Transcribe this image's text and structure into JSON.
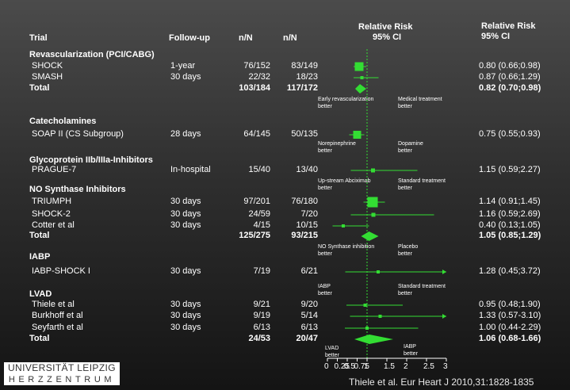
{
  "logo": {
    "line1": "UNIVERSITÄT LEIPZIG",
    "line2": "HERZZENTRUM"
  },
  "citation": "Thiele et al. Eur Heart J 2010,31:1828-1835",
  "chart_data": {
    "type": "forest",
    "headers": {
      "trial": "Trial",
      "followup": "Follow-up",
      "n1": "n/N",
      "n2": "n/N",
      "rr_line1": "Relative Risk",
      "rr_line2": "95% CI",
      "est_line1": "Relative Risk",
      "est_line2": "95% CI"
    },
    "axis": {
      "min": 0,
      "max": 3,
      "ticks": [
        0,
        0.25,
        0.5,
        0.75,
        1,
        1.5,
        2,
        2.5,
        3
      ],
      "tick_labels": [
        "0",
        "0.25",
        "0.5",
        "0.75",
        "1",
        "1.5",
        "2",
        "2.5",
        "3"
      ],
      "reference_line": 1,
      "left_label": "LVAD\nbetter",
      "right_label": "IABP\nbetter"
    },
    "colors": {
      "marker": "#33dd33",
      "text": "#ffffff",
      "reference": "#33dd33"
    },
    "rows": [
      {
        "kind": "section",
        "label": "Revascularization (PCI/CABG)"
      },
      {
        "kind": "study",
        "label": "SHOCK",
        "followup": "1-year",
        "n1": "76/152",
        "n2": "83/149",
        "rr": 0.8,
        "lo": 0.66,
        "hi": 0.98,
        "est": "0.80 (0.66;0.98)"
      },
      {
        "kind": "study",
        "label": "SMASH",
        "followup": "30 days",
        "n1": "22/32",
        "n2": "18/23",
        "rr": 0.87,
        "lo": 0.66,
        "hi": 1.29,
        "est": "0.87 (0.66;1.29)"
      },
      {
        "kind": "total",
        "label": "Total",
        "n1": "103/184",
        "n2": "117/172",
        "rr": 0.82,
        "lo": 0.7,
        "hi": 0.98,
        "est": "0.82 (0.70;0.98)"
      },
      {
        "kind": "favours",
        "left": "Early revascularization\nbetter",
        "right": "Medical treatment\nbetter"
      },
      {
        "kind": "section",
        "label": "Catecholamines"
      },
      {
        "kind": "study",
        "label": "SOAP II (CS Subgroup)",
        "followup": "28 days",
        "n1": "64/145",
        "n2": "50/135",
        "rr": 0.75,
        "lo": 0.55,
        "hi": 0.93,
        "est": "0.75 (0.55;0.93)"
      },
      {
        "kind": "favours",
        "left": "Norepinephrine\nbetter",
        "right": "Dopamine\nbetter"
      },
      {
        "kind": "section",
        "label": "Glycoprotein IIb/IIIa-Inhibitors"
      },
      {
        "kind": "study",
        "label": "PRAGUE-7",
        "followup": "In-hospital",
        "n1": "15/40",
        "n2": "13/40",
        "rr": 1.15,
        "lo": 0.59,
        "hi": 2.27,
        "est": "1.15 (0.59;2.27)"
      },
      {
        "kind": "favours",
        "left": "Up-stream Abciximab\nbetter",
        "right": "Standard treatment\nbetter"
      },
      {
        "kind": "section",
        "label": "NO Synthase Inhibitors"
      },
      {
        "kind": "study",
        "label": "TRIUMPH",
        "followup": "30 days",
        "n1": "97/201",
        "n2": "76/180",
        "rr": 1.14,
        "lo": 0.91,
        "hi": 1.45,
        "est": "1.14 (0.91;1.45)"
      },
      {
        "kind": "study",
        "label": "SHOCK-2",
        "followup": "30 days",
        "n1": "24/59",
        "n2": "7/20",
        "rr": 1.16,
        "lo": 0.59,
        "hi": 2.69,
        "est": "1.16 (0.59;2.69)"
      },
      {
        "kind": "study",
        "label": "Cotter et al",
        "followup": "30 days",
        "n1": "4/15",
        "n2": "10/15",
        "rr": 0.4,
        "lo": 0.13,
        "hi": 1.05,
        "est": "0.40 (0.13;1.05)"
      },
      {
        "kind": "total",
        "label": "Total",
        "n1": "125/275",
        "n2": "93/215",
        "rr": 1.05,
        "lo": 0.85,
        "hi": 1.29,
        "est": "1.05 (0.85;1.29)"
      },
      {
        "kind": "favours",
        "left": "NO Synthase inhibition\nbetter",
        "right": "Placebo\nbetter"
      },
      {
        "kind": "section",
        "label": "IABP"
      },
      {
        "kind": "study",
        "label": "IABP-SHOCK I",
        "followup": "30 days",
        "n1": "7/19",
        "n2": "6/21",
        "rr": 1.28,
        "lo": 0.45,
        "hi": 3.72,
        "est": "1.28 (0.45;3.72)"
      },
      {
        "kind": "favours",
        "left": "IABP\nbetter",
        "right": "Standard treatment\nbetter"
      },
      {
        "kind": "section",
        "label": "LVAD"
      },
      {
        "kind": "study",
        "label": "Thiele et al",
        "followup": "30 days",
        "n1": "9/21",
        "n2": "9/20",
        "rr": 0.95,
        "lo": 0.48,
        "hi": 1.9,
        "est": "0.95 (0.48;1.90)"
      },
      {
        "kind": "study",
        "label": "Burkhoff et al",
        "followup": "30 days",
        "n1": "9/19",
        "n2": "5/14",
        "rr": 1.33,
        "lo": 0.57,
        "hi": 3.1,
        "est": "1.33 (0.57-3.10)"
      },
      {
        "kind": "study",
        "label": "Seyfarth et al",
        "followup": "30 days",
        "n1": "6/13",
        "n2": "6/13",
        "rr": 1.0,
        "lo": 0.44,
        "hi": 2.29,
        "est": "1.00 (0.44-2.29)"
      },
      {
        "kind": "total",
        "label": "Total",
        "n1": "24/53",
        "n2": "20/47",
        "rr": 1.06,
        "lo": 0.68,
        "hi": 1.66,
        "est": "1.06 (0.68-1.66)"
      }
    ]
  }
}
